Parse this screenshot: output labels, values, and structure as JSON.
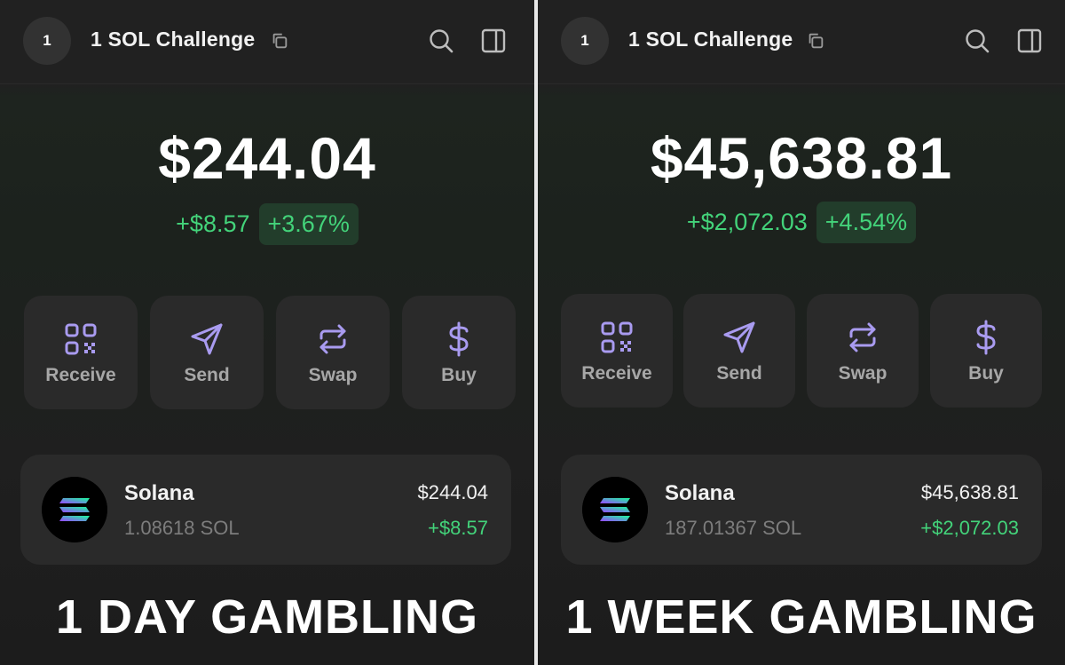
{
  "colors": {
    "positive": "#43d37a",
    "positive_bg": "#223d2b",
    "accent_icon": "#a99bf0",
    "card_bg": "#2a2a2a"
  },
  "left": {
    "avatar_label": "1",
    "account_name": "1 SOL Challenge",
    "balance": "$244.04",
    "change_abs": "+$8.57",
    "change_pct": "+3.67%",
    "actions": [
      {
        "label": "Receive",
        "icon": "qr-code-icon"
      },
      {
        "label": "Send",
        "icon": "send-icon"
      },
      {
        "label": "Swap",
        "icon": "swap-icon"
      },
      {
        "label": "Buy",
        "icon": "dollar-icon"
      }
    ],
    "token": {
      "name": "Solana",
      "amount": "1.08618 SOL",
      "value": "$244.04",
      "change": "+$8.57",
      "icon": "solana-logo-icon"
    },
    "caption": "1 DAY GAMBLING"
  },
  "right": {
    "avatar_label": "1",
    "account_name": "1 SOL Challenge",
    "balance": "$45,638.81",
    "change_abs": "+$2,072.03",
    "change_pct": "+4.54%",
    "actions": [
      {
        "label": "Receive",
        "icon": "qr-code-icon"
      },
      {
        "label": "Send",
        "icon": "send-icon"
      },
      {
        "label": "Swap",
        "icon": "swap-icon"
      },
      {
        "label": "Buy",
        "icon": "dollar-icon"
      }
    ],
    "token": {
      "name": "Solana",
      "amount": "187.01367 SOL",
      "value": "$45,638.81",
      "change": "+$2,072.03",
      "icon": "solana-logo-icon"
    },
    "caption": "1 WEEK GAMBLING"
  }
}
